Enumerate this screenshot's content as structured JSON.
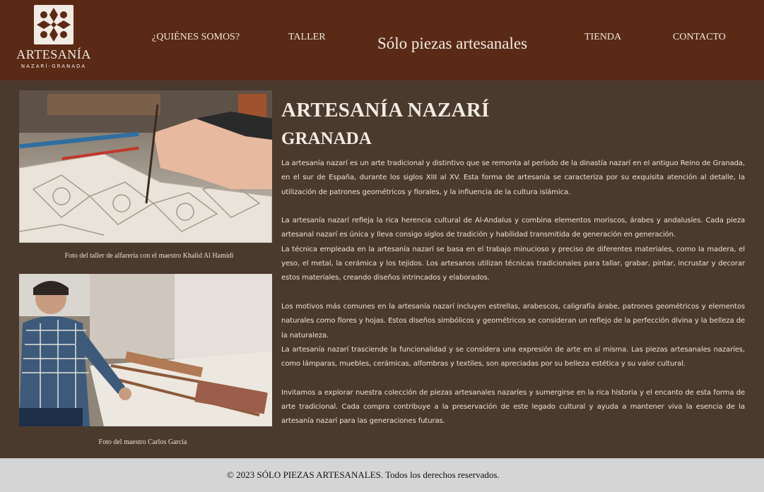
{
  "brand": {
    "title": "ARTESANÍA",
    "subtitle": "NAZARÍ-GRANADA",
    "logo_icon": "geometric-star-pattern-icon"
  },
  "nav": {
    "quienes": "¿QUIÉNES SOMOS?",
    "taller": "TALLER",
    "tienda": "TIENDA",
    "contacto": "CONTACTO"
  },
  "tagline": "Sólo piezas artesanales",
  "photos": [
    {
      "caption": "Foto del taller de alfarería con el maestro Khalid Al Hamidi"
    },
    {
      "caption": "Foto del maestro Carlos García"
    }
  ],
  "article": {
    "title": "ARTESANÍA NAZARÍ",
    "subtitle": "GRANADA",
    "p1": "La artesanía nazarí es un arte tradicional y distintivo que se remonta al período de la dinastía nazarí en el antiguo Reino de Granada, en el sur de España, durante los siglos XIII al XV. Esta forma de artesanía se caracteriza por su exquisita atención al detalle, la utilización de patrones geométricos y florales, y la influencia de la cultura islámica.",
    "p2": "La artesanía nazarí refleja la rica herencia cultural de Al-Andalus y combina elementos moriscos, árabes y andalusíes. Cada pieza artesanal nazarí es única y lleva consigo siglos de tradición y habilidad transmitida de generación en generación.",
    "p3": "La técnica empleada en la artesanía nazarí se basa en el trabajo minucioso y preciso de diferentes materiales, como la madera, el yeso, el metal, la cerámica y los tejidos. Los artesanos utilizan técnicas tradicionales para tallar, grabar, pintar, incrustar y decorar estos materiales, creando diseños intrincados y elaborados.",
    "p4": "Los motivos más comunes en la artesanía nazarí incluyen estrellas, arabescos, caligrafía árabe, patrones geométricos y elementos naturales como flores y hojas. Estos diseños simbólicos y geométricos se consideran un reflejo de la perfección divina y la belleza de la naturaleza.",
    "p5": "La artesanía nazarí trasciende la funcionalidad y se considera una expresión de arte en sí misma. Las piezas artesanales nazaríes, como lámparas, muebles, cerámicas, alfombras y textiles, son apreciadas por su belleza estética y su valor cultural.",
    "p6": "Invitamos a explorar nuestra colección de piezas artesanales nazaríes y sumergirse en la rica historia y el encanto de esta forma de arte tradicional. Cada compra contribuye a la preservación de este legado cultural y ayuda a mantener viva la esencia de la artesanía nazarí para las generaciones futuras."
  },
  "footer": {
    "text": "© 2023 SÓLO PIEZAS ARTESANALES. Todos los derechos reservados."
  },
  "colors": {
    "header_bg": "#5a2a16",
    "main_bg": "#4a3a2e",
    "footer_bg": "#d5d5d5"
  }
}
